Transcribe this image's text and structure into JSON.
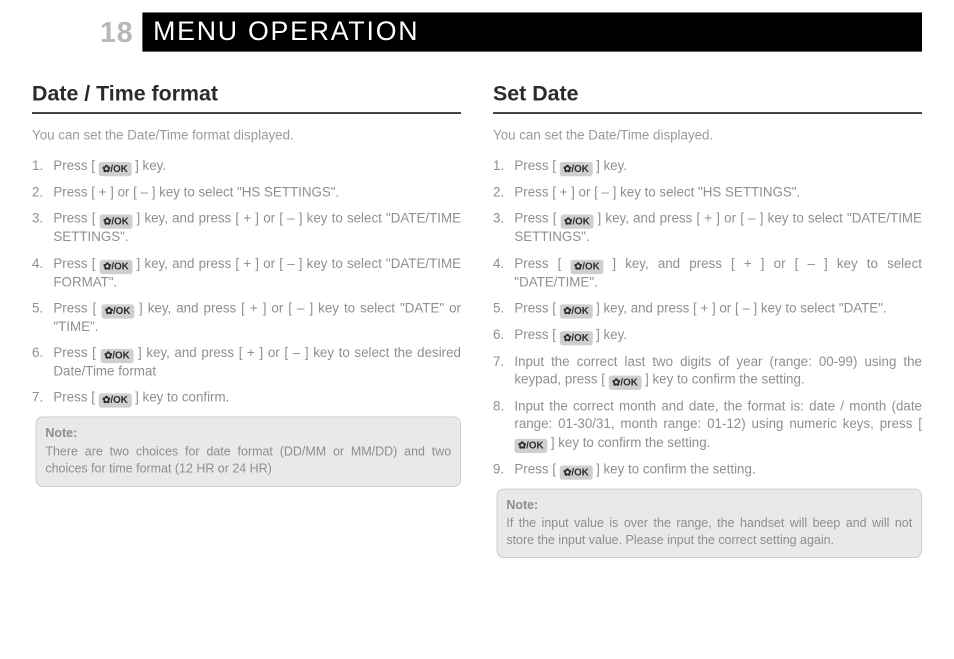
{
  "header": {
    "page_number": "18",
    "title": "MENU OPERATION"
  },
  "icon_labels": {
    "ok_key_text": "/OK",
    "ok_key_gear": "✿"
  },
  "left": {
    "heading": "Date / Time format",
    "intro": "You can set the Date/Time format displayed.",
    "steps": [
      {
        "pre": "Press [ ",
        "icon": true,
        "post": " ] key."
      },
      {
        "pre": "Press [ + ] or [ – ] key to select \"HS SETTINGS\".",
        "icon": false,
        "post": ""
      },
      {
        "pre": "Press [ ",
        "icon": true,
        "post": " ] key, and press [ + ] or [ – ] key to select \"DATE/TIME SETTINGS\"."
      },
      {
        "pre": "Press [ ",
        "icon": true,
        "post": " ] key, and press [ + ] or [ – ] key to select \"DATE/TIME FORMAT\"."
      },
      {
        "pre": "Press [ ",
        "icon": true,
        "post": " ] key, and press [ + ] or [ – ] key to select \"DATE\" or \"TIME\"."
      },
      {
        "pre": "Press [ ",
        "icon": true,
        "post": " ] key, and press [ + ] or [ – ] key to select the desired Date/Time format"
      },
      {
        "pre": "Press [ ",
        "icon": true,
        "post": " ] key to confirm."
      }
    ],
    "note": {
      "label": "Note:",
      "body": "There are two choices for date format (DD/MM or MM/DD) and two choices for time format (12 HR or 24 HR)"
    }
  },
  "right": {
    "heading": "Set Date",
    "intro": "You can set the Date/Time displayed.",
    "steps": [
      {
        "pre": "Press [ ",
        "icon": true,
        "post": " ] key."
      },
      {
        "pre": "Press [ + ] or [ – ] key to select \"HS SETTINGS\".",
        "icon": false,
        "post": ""
      },
      {
        "pre": "Press [ ",
        "icon": true,
        "post": " ] key, and press [ + ] or [ – ] key to select \"DATE/TIME SETTINGS\"."
      },
      {
        "pre": "Press [ ",
        "icon": true,
        "post": " ] key, and press [ + ] or [ – ] key to select \"DATE/TIME\"."
      },
      {
        "pre": "Press [ ",
        "icon": true,
        "post": " ] key, and press [ + ] or [ – ] key to select \"DATE\"."
      },
      {
        "pre": "Press [ ",
        "icon": true,
        "post": " ] key."
      },
      {
        "pre": "Input the correct last two digits of year (range: 00-99) using the keypad, press [ ",
        "icon": true,
        "post": " ] key to confirm the setting."
      },
      {
        "pre": "Input the correct month and date, the format is: date / month (date range: 01-30/31, month range: 01-12) using numeric keys, press [ ",
        "icon": true,
        "post": " ] key to confirm the setting."
      },
      {
        "pre": "Press [ ",
        "icon": true,
        "post": " ] key to confirm the setting."
      }
    ],
    "note": {
      "label": "Note:",
      "body": "If the input value is over the range, the handset will beep and will not store the input value. Please input the correct setting again."
    }
  }
}
